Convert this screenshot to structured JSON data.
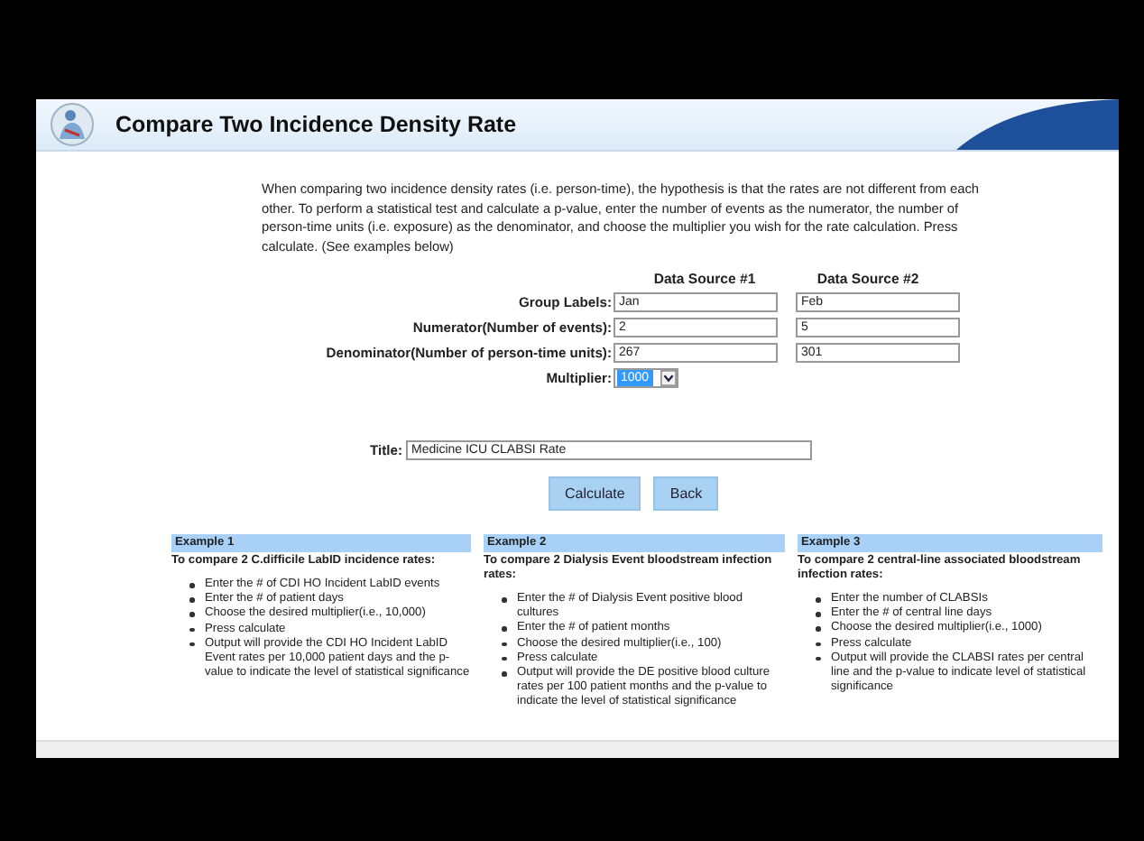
{
  "header": {
    "title": "Compare Two Incidence Density Rate"
  },
  "intro": "When comparing two incidence density rates (i.e. person-time), the hypothesis is that the rates are not different from each other. To perform a statistical test and calculate a p-value, enter the number of events as the numerator, the number of person-time units (i.e. exposure) as the denominator, and choose the multiplier you wish for the rate calculation. Press calculate. (See examples below)",
  "form": {
    "columns": [
      "Data Source #1",
      "Data Source #2"
    ],
    "rows": [
      {
        "label": "Group Labels:",
        "values": [
          "Jan",
          "Feb"
        ]
      },
      {
        "label": "Numerator(Number of events):",
        "values": [
          "2",
          "5"
        ]
      },
      {
        "label": "Denominator(Number of person-time units):",
        "values": [
          "267",
          "301"
        ]
      }
    ],
    "multiplier": {
      "label": "Multiplier:",
      "value": "1000"
    },
    "title_field": {
      "label": "Title:",
      "value": "Medicine ICU CLABSI Rate"
    },
    "buttons": [
      "Calculate",
      "Back"
    ]
  },
  "examples": [
    {
      "heading": "Example 1",
      "subtitle": "To compare 2 C.difficile LabID incidence rates:",
      "items": [
        "Enter the # of CDI HO Incident LabID events",
        "Enter the # of patient days",
        "Choose the desired multiplier(i.e., 10,000)",
        "Press calculate",
        "Output will provide the CDI HO Incident LabID Event rates per 10,000 patient days and the p-value to indicate the level of statistical significance"
      ]
    },
    {
      "heading": "Example 2",
      "subtitle": "To compare 2 Dialysis Event bloodstream infection rates:",
      "items": [
        "Enter the # of Dialysis Event positive blood cultures",
        "Enter the # of patient months",
        "Choose the desired multiplier(i.e., 100)",
        "Press calculate",
        "Output will provide the DE positive blood culture rates per 100 patient months and the p-value to indicate the level of statistical significance"
      ]
    },
    {
      "heading": "Example 3",
      "subtitle": "To compare 2 central-line associated bloodstream infection rates:",
      "items": [
        "Enter the number of CLABSIs",
        "Enter the # of central line days",
        "Choose the desired multiplier(i.e., 1000)",
        "Press calculate",
        "Output will provide the CLABSI rates per central line and the p-value to indicate level of statistical significance"
      ]
    }
  ]
}
